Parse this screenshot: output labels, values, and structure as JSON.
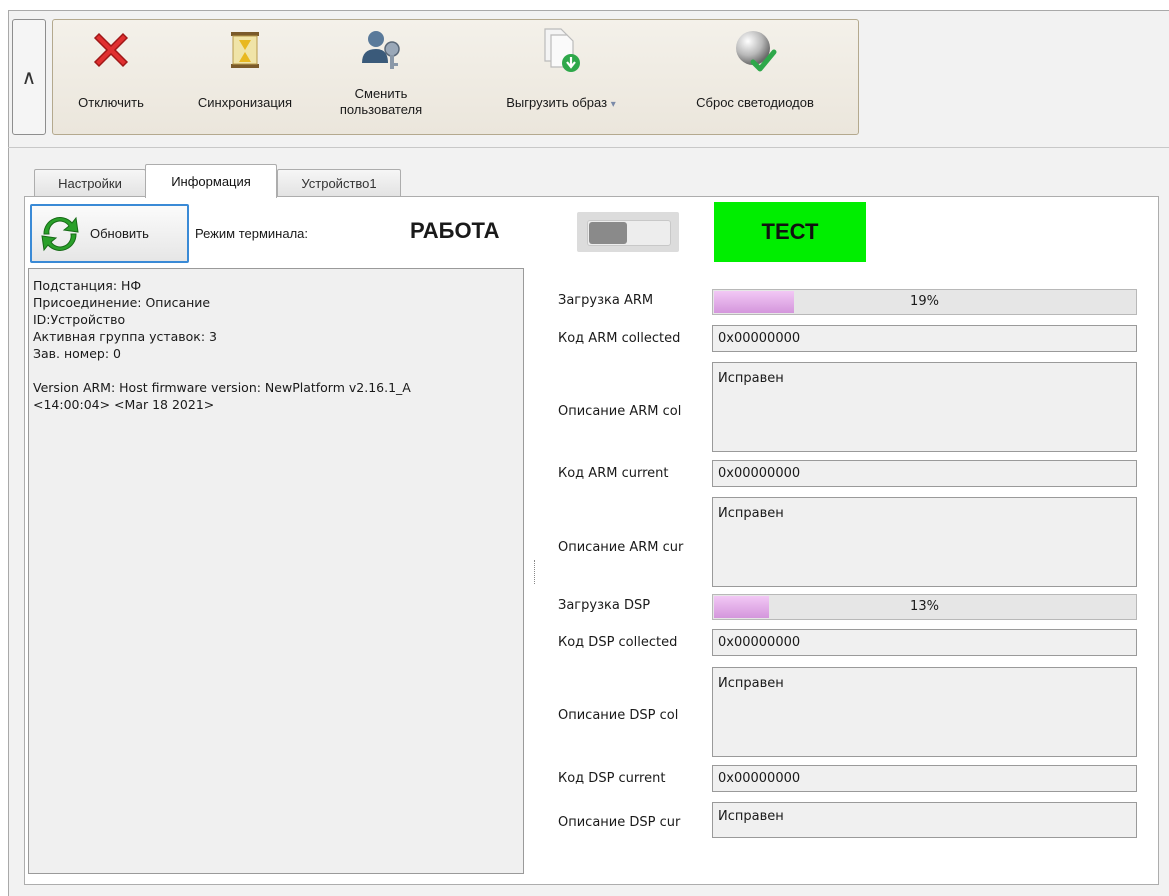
{
  "toolbar": {
    "collapse_glyph": "∧",
    "disconnect": {
      "label": "Отключить",
      "icon": "red-x-icon"
    },
    "sync": {
      "label": "Синхронизация",
      "icon": "hourglass-icon"
    },
    "switch_user": {
      "label_line1": "Сменить",
      "label_line2": "пользователя",
      "icon": "user-key-icon"
    },
    "export_image": {
      "label": "Выгрузить образ",
      "dropdown_glyph": "▾",
      "icon": "document-download-icon"
    },
    "reset_leds": {
      "label": "Сброс светодиодов",
      "icon": "globe-checkmark-icon"
    }
  },
  "tabs": [
    {
      "label": "Настройки",
      "active": false
    },
    {
      "label": "Информация",
      "active": true
    },
    {
      "label": "Устройство1",
      "active": false
    }
  ],
  "header": {
    "refresh_label": "Обновить",
    "mode_label": "Режим терминала:",
    "mode_value": "РАБОТА",
    "test_label": "ТЕСТ",
    "test_color": "#00ee00",
    "toggle_state": "off"
  },
  "info": {
    "lines": [
      "Подстанция: НФ",
      "Присоединение: Описание",
      "ID:Устройство",
      "Активная группа уставок: 3",
      "Зав. номер: 0",
      "",
      "Version ARM: Host firmware version: NewPlatform v2.16.1_A",
      "<14:00:04> <Mar 18 2021>"
    ]
  },
  "fields": {
    "arm_load": {
      "label": "Загрузка ARM",
      "percent": 19,
      "text": "19%"
    },
    "arm_collected_code": {
      "label": "Код ARM collected",
      "value": "0x00000000"
    },
    "arm_collected_desc": {
      "label": "Описание ARM col",
      "value": "Исправен"
    },
    "arm_current_code": {
      "label": "Код ARM current",
      "value": "0x00000000"
    },
    "arm_current_desc": {
      "label": "Описание ARM cur",
      "value": "Исправен"
    },
    "dsp_load": {
      "label": "Загрузка DSP",
      "percent": 13,
      "text": "13%"
    },
    "dsp_collected_code": {
      "label": "Код DSP collected",
      "value": "0x00000000"
    },
    "dsp_collected_desc": {
      "label": "Описание DSP col",
      "value": "Исправен"
    },
    "dsp_current_code": {
      "label": "Код DSP current",
      "value": "0x00000000"
    },
    "dsp_current_desc": {
      "label": "Описание DSP cur",
      "value": "Исправен"
    }
  },
  "colors": {
    "progress_fill": "#d9a0e0",
    "focus_border": "#3a8ad6"
  }
}
